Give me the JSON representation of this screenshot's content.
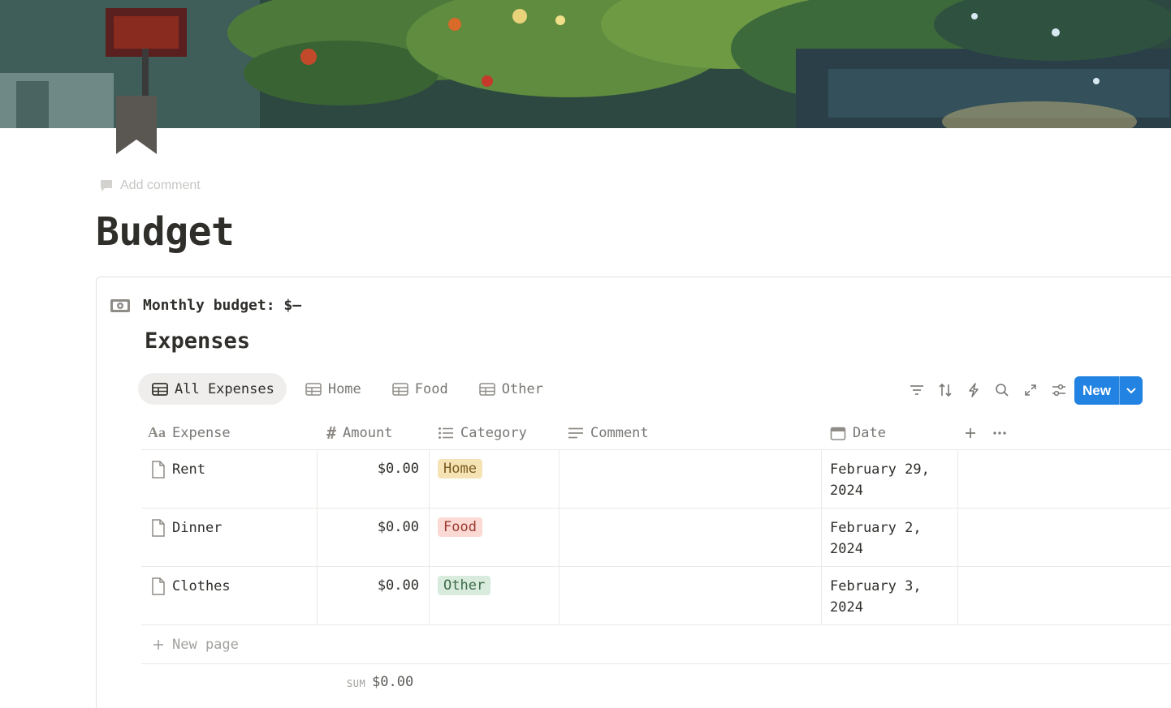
{
  "page": {
    "add_comment": "Add comment",
    "title": "Budget",
    "icon": "bookmark-icon"
  },
  "callout": {
    "icon": "money-icon",
    "text": "Monthly budget: $–"
  },
  "database": {
    "title": "Expenses",
    "tabs": [
      {
        "label": "All Expenses",
        "icon": "table-icon",
        "active": true
      },
      {
        "label": "Home",
        "icon": "table-icon"
      },
      {
        "label": "Food",
        "icon": "table-icon"
      },
      {
        "label": "Other",
        "icon": "table-icon"
      }
    ],
    "toolbar": {
      "icons": [
        "filter-icon",
        "sort-icon",
        "automation-icon",
        "search-icon",
        "expand-icon",
        "settings-icon"
      ],
      "new_label": "New"
    },
    "columns": [
      {
        "label": "Expense",
        "icon": "title-icon"
      },
      {
        "label": "Amount",
        "icon": "number-icon"
      },
      {
        "label": "Category",
        "icon": "list-icon"
      },
      {
        "label": "Comment",
        "icon": "text-icon"
      },
      {
        "label": "Date",
        "icon": "calendar-icon"
      }
    ],
    "rows": [
      {
        "expense": "Rent",
        "amount": "$0.00",
        "category": "Home",
        "comment": "",
        "date": "February 29, 2024"
      },
      {
        "expense": "Dinner",
        "amount": "$0.00",
        "category": "Food",
        "comment": "",
        "date": "February 2, 2024"
      },
      {
        "expense": "Clothes",
        "amount": "$0.00",
        "category": "Other",
        "comment": "",
        "date": "February 3, 2024"
      }
    ],
    "new_page": "New page",
    "sum": {
      "label": "SUM",
      "value": "$0.00"
    }
  },
  "colors": {
    "accent": "#2383e2",
    "tag_home_bg": "#f5e3b5",
    "tag_home_fg": "#7a5a1d",
    "tag_food_bg": "#fbd9d4",
    "tag_food_fg": "#9b3b2f",
    "tag_other_bg": "#d8ebdc",
    "tag_other_fg": "#3e6b4a"
  }
}
